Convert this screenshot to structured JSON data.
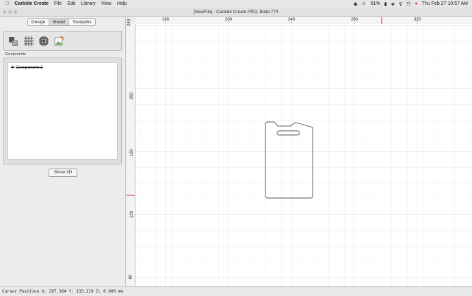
{
  "menubar": {
    "app_name": "Carbide Create",
    "menus": [
      "File",
      "Edit",
      "Library",
      "View",
      "Help"
    ],
    "battery": "61%",
    "clock": "Thu Feb 27  10:57 AM"
  },
  "window": {
    "title": "[NewFile] - Carbide Create PRO, Build 774"
  },
  "left_panel": {
    "tabs": [
      "Design",
      "Model",
      "Toolpaths"
    ],
    "active_tab": "Model",
    "components_label": "Components",
    "components": [
      {
        "label": "Component-1",
        "expand": "+"
      }
    ],
    "show3d_label": "Show 3D"
  },
  "rulers": {
    "top_ticks": [
      "160",
      "200",
      "240",
      "280",
      "320"
    ],
    "left_ticks": [
      "240",
      "200",
      "160",
      "120",
      "80"
    ]
  },
  "status_bar": {
    "text": "Cursor Position X: 297.364 Y: 133.219 Z: 0.000 mm"
  },
  "colors": {
    "accent_marker": "#e03030",
    "grid_minor": "#e8e8e8",
    "grid_major": "#cfcfcf"
  }
}
